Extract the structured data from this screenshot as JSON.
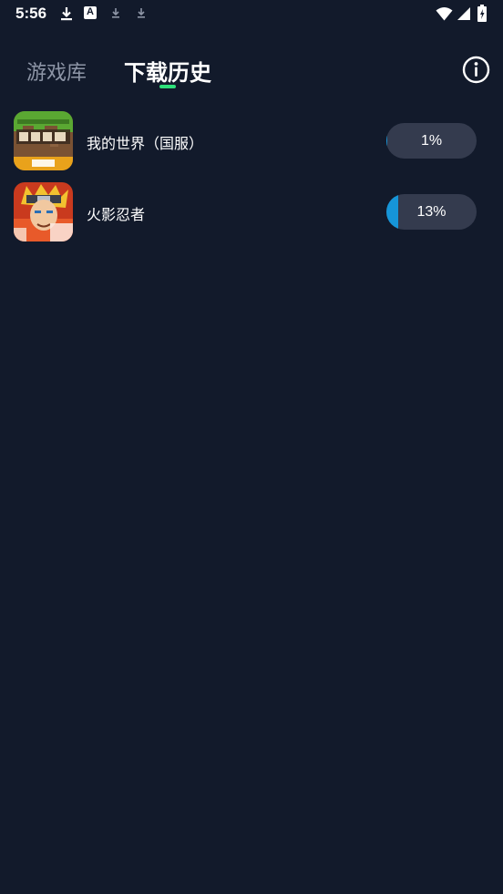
{
  "status_bar": {
    "time": "5:56",
    "icons": [
      "download-icon",
      "a-app-icon",
      "download-icon",
      "download-icon",
      "wifi-icon",
      "signal-icon",
      "battery-charging-icon"
    ]
  },
  "header": {
    "tabs": [
      {
        "label": "游戏库",
        "active": false
      },
      {
        "label": "下载历史",
        "active": true
      }
    ],
    "accent_color": "#2ee07a",
    "info_icon": "info-icon"
  },
  "downloads": [
    {
      "name": "我的世界（国服）",
      "progress": 0.01,
      "progress_label": "1%",
      "icon": "minecraft-icon"
    },
    {
      "name": "火影忍者",
      "progress": 0.13,
      "progress_label": "13%",
      "icon": "naruto-icon"
    }
  ],
  "colors": {
    "background": "#121a2b",
    "progress_track": "#343b4e",
    "progress_fill": "#1695d8"
  }
}
